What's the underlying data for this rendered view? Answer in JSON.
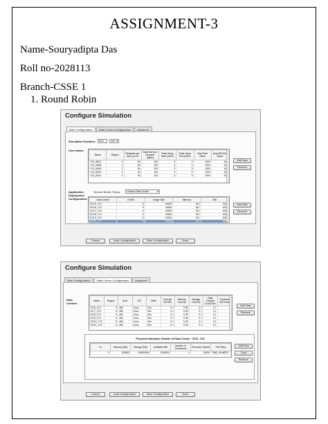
{
  "doc": {
    "title": "ASSIGNMENT-3",
    "name_line": "Name-Souryadipta Das",
    "roll_line": "Roll no-2028113",
    "branch_line": "Branch-CSSE 1",
    "item_number": "1.",
    "item_text": "Round Robin"
  },
  "shot1": {
    "header": "Configure Simulation",
    "tabs": [
      "Main Configuration",
      "Data Center Configuration",
      "Advanced"
    ],
    "sim_duration_label": "Simulation Duration:",
    "sim_duration_value": "60.0",
    "sim_duration_unit": "min",
    "user_bases_label": "User bases:",
    "ub_headers": [
      "Name",
      "Region",
      "Requests per User per Hr",
      "Data Size per Request (bytes)",
      "Peak Hours Start (GMT)",
      "Peak Hours End (GMT)",
      "Avg Peak Users",
      "Avg Off-Peak Users"
    ],
    "ub_rows": [
      [
        "Y11_UB07",
        "4",
        "60",
        "100",
        "3",
        "9",
        "1000",
        "100"
      ],
      [
        "Y12_UB08",
        "0",
        "60",
        "100",
        "3",
        "9",
        "1000",
        "100"
      ],
      [
        "Y13_UB09",
        "2",
        "60",
        "100",
        "3",
        "9",
        "1000",
        "100"
      ],
      [
        "Y14_UB10",
        "4",
        "60",
        "100",
        "3",
        "9",
        "1000",
        "100"
      ],
      [
        "Y15_UB11",
        "0",
        "60",
        "100",
        "3",
        "9",
        "1000",
        "100"
      ]
    ],
    "add_new": "Add New",
    "remove": "Remove",
    "deploy_label_1": "Application",
    "deploy_label_2": "Deployment",
    "deploy_label_3": "Configuration:",
    "broker_label": "Service Broker Policy:",
    "broker_value": "Closest Data Center",
    "dc_headers": [
      "Data Center",
      "# VMs",
      "Image Size",
      "Memory",
      "BW"
    ],
    "dc_rows": [
      [
        "DC15_Y13",
        "5",
        "10000",
        "512",
        "1000"
      ],
      [
        "DC16_Y13",
        "5",
        "10000",
        "512",
        "1000"
      ],
      [
        "DC17_Y13",
        "5",
        "10000",
        "512",
        "1000"
      ],
      [
        "DC18_Y13",
        "5",
        "10000",
        "512",
        "1000"
      ],
      [
        "DC19_Y13",
        "5",
        "10000",
        "512",
        "1000"
      ],
      [
        "DC20_Y13",
        "5",
        "10000",
        "512",
        "1000"
      ]
    ],
    "buttons": [
      "Cancel",
      "Load Configuration",
      "Save Configuration",
      "Done"
    ]
  },
  "shot2": {
    "header": "Configure Simulation",
    "tabs": [
      "Main Configuration",
      "Data Center Configuration",
      "Advanced"
    ],
    "dc_label_1": "Data",
    "dc_label_2": "Centers:",
    "dc_headers": [
      "Name",
      "Region",
      "Arch",
      "OS",
      "VMM",
      "Cost per VM $/Hr",
      "Memory Cost $/s",
      "Storage Cost $/s",
      "Data Transfer Cost $/Gb",
      "Physical HW Units"
    ],
    "dc_rows": [
      [
        "DC5_Y13",
        "5",
        "x86",
        "Linux",
        "Xen",
        "0.1",
        "0.05",
        "0.1",
        "0.1",
        "1"
      ],
      [
        "DC7_Y13",
        "5",
        "x86",
        "Linux",
        "Xen",
        "0.1",
        "0.05",
        "0.1",
        "0.1",
        "1"
      ],
      [
        "DC8_Y13",
        "5",
        "x86",
        "Linux",
        "Xen",
        "0.1",
        "0.05",
        "0.1",
        "0.1",
        "1"
      ],
      [
        "DC9_Y13",
        "5",
        "x86",
        "Linux",
        "Xen",
        "0.1",
        "0.05",
        "0.1",
        "0.1",
        "1"
      ],
      [
        "DC10_Y13",
        "5",
        "x86",
        "Linux",
        "Xen",
        "0.1",
        "0.05",
        "0.1",
        "0.1",
        "1"
      ],
      [
        "DC11_Y13",
        "5",
        "x86",
        "Linux",
        "Xen",
        "0.1",
        "0.05",
        "0.1",
        "0.1",
        "1"
      ]
    ],
    "add_new": "Add New",
    "remove": "Remove",
    "phys_title": "Physical Hardware Details of Data Center : DC5_Y13",
    "phys_headers": [
      "Id",
      "Memory (Mb)",
      "Storage (Mb)",
      "Available BW",
      "Number of Processors",
      "Processor Speed",
      "VM Policy"
    ],
    "phys_rows": [
      [
        "0",
        "204800",
        "100000000",
        "1000000",
        "4",
        "10000",
        "TIME_SHARED"
      ]
    ],
    "phys_add": "Add New",
    "phys_copy": "Copy",
    "phys_remove": "Remove",
    "buttons": [
      "Cancel",
      "Load Configuration",
      "Save Configuration",
      "Done"
    ]
  }
}
